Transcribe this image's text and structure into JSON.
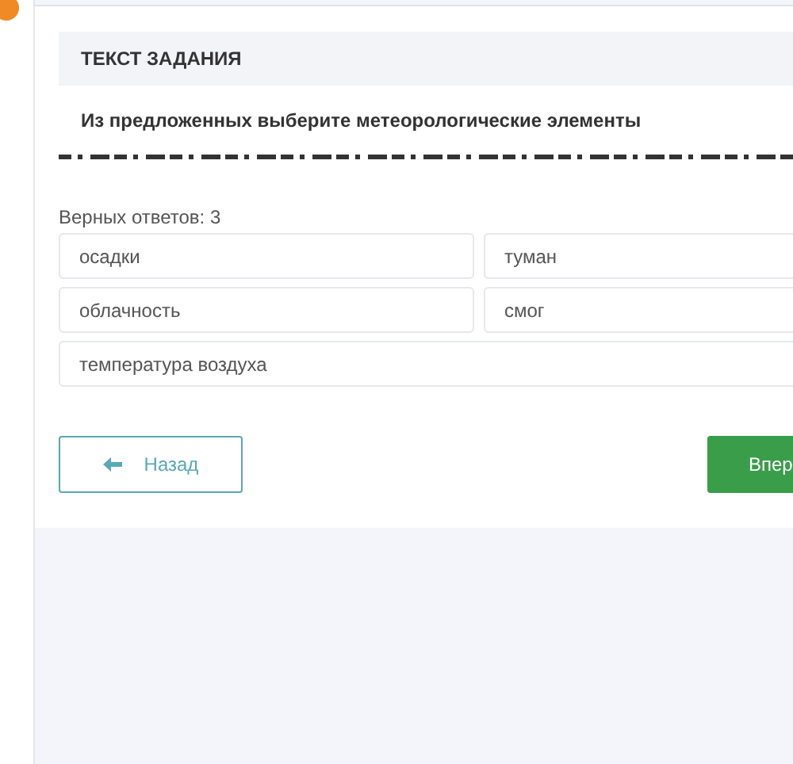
{
  "task_header": "ТЕКСТ ЗАДАНИЯ",
  "question": "Из предложенных выберите метеорологические элементы",
  "correct_count": "Верных ответов: 3",
  "options": [
    {
      "label": "осадки"
    },
    {
      "label": "туман"
    },
    {
      "label": "облачность"
    },
    {
      "label": "смог"
    },
    {
      "label": "температура воздуха"
    }
  ],
  "back_button": "Назад",
  "next_button": "Впер"
}
